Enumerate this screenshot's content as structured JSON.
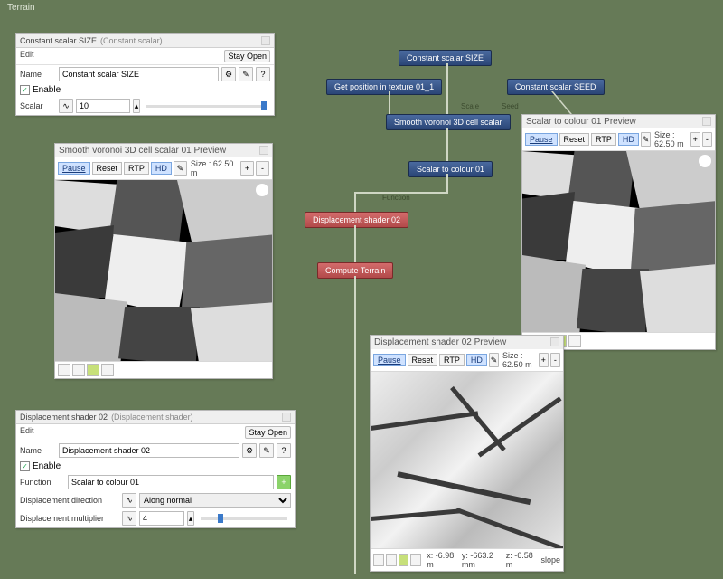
{
  "canvas": {
    "title": "Terrain"
  },
  "nodes": {
    "size": {
      "label": "Constant scalar SIZE"
    },
    "getpos": {
      "label": "Get position in texture 01_1"
    },
    "seed": {
      "label": "Constant scalar SEED"
    },
    "voronoi": {
      "label": "Smooth voronoi 3D cell scalar"
    },
    "scolour": {
      "label": "Scalar to colour 01"
    },
    "disp": {
      "label": "Displacement shader 02"
    },
    "compute": {
      "label": "Compute Terrain"
    }
  },
  "wire_labels": {
    "scale": "Scale",
    "seed": "Seed",
    "function": "Function"
  },
  "panel_const": {
    "title": "Constant scalar SIZE",
    "type": "(Constant scalar)",
    "menu": "Edit",
    "stay": "Stay Open",
    "name_label": "Name",
    "name_value": "Constant scalar SIZE",
    "enable_label": "Enable",
    "enable_checked": true,
    "scalar_label": "Scalar",
    "scalar_value": "10",
    "gear": "⚙",
    "pencil": "✎",
    "help": "?"
  },
  "panel_disp": {
    "title": "Displacement shader 02",
    "type": "(Displacement shader)",
    "menu": "Edit",
    "stay": "Stay Open",
    "name_label": "Name",
    "name_value": "Displacement shader 02",
    "enable_label": "Enable",
    "enable_checked": true,
    "function_label": "Function",
    "function_value": "Scalar to colour 01",
    "dir_label": "Displacement direction",
    "dir_value": "Along normal",
    "mult_label": "Displacement multiplier",
    "mult_value": "4",
    "gear": "⚙",
    "pencil": "✎",
    "help": "?",
    "plus": "+"
  },
  "preview_common": {
    "pause": "Pause",
    "reset": "Reset",
    "rtp": "RTP",
    "hd": "HD",
    "brush": "✎",
    "size": "Size : 62.50 m",
    "plus": "+",
    "minus": "-"
  },
  "preview_voronoi": {
    "title": "Smooth voronoi 3D cell scalar 01 Preview"
  },
  "preview_scolour": {
    "title": "Scalar to colour 01 Preview"
  },
  "preview_terrain": {
    "title": "Displacement shader 02 Preview",
    "coords": {
      "x": "x: -6.98 m",
      "y": "y: -663.2 mm",
      "z": "z: -6.58 m",
      "slope": "slope"
    }
  }
}
